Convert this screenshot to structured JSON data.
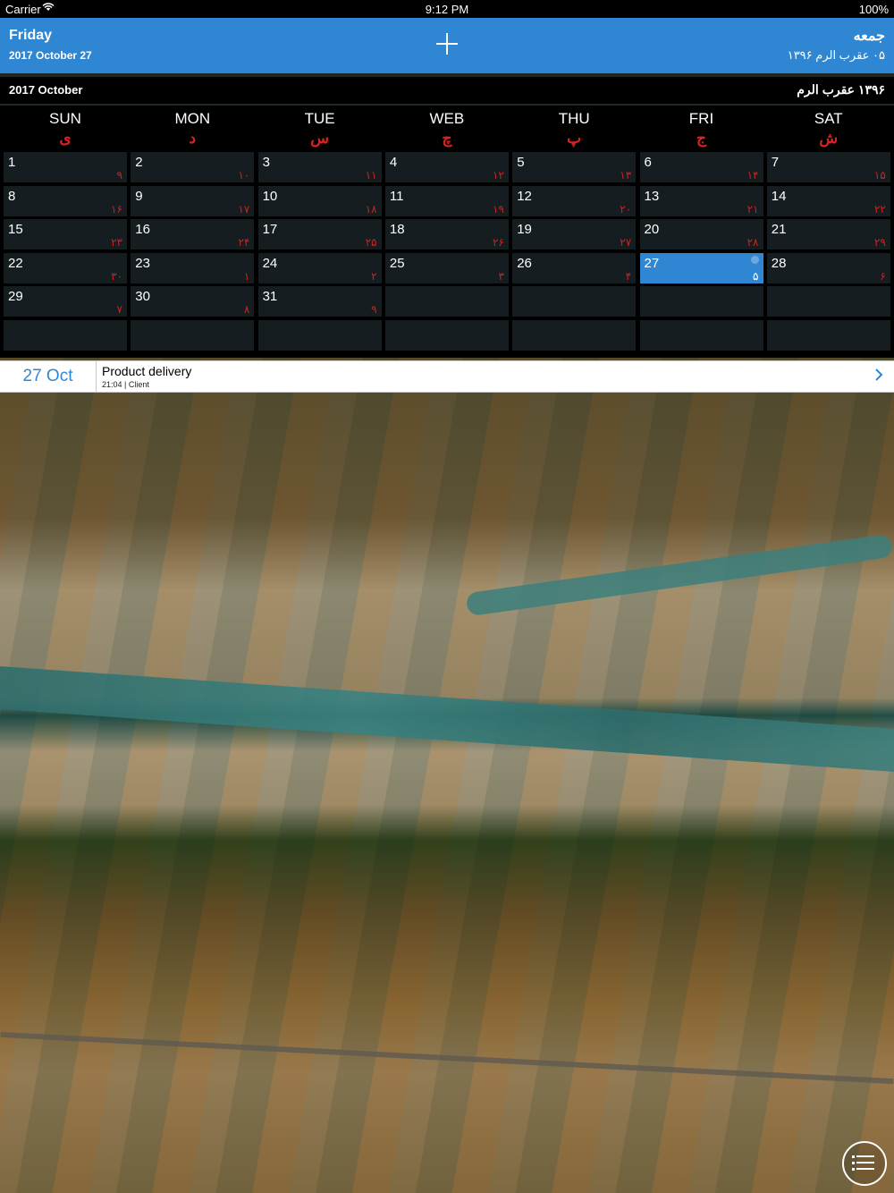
{
  "status_bar": {
    "carrier": "Carrier",
    "time": "9:12 PM",
    "battery": "100%"
  },
  "header": {
    "day_en": "Friday",
    "date_en": "2017 October 27",
    "day_fa": "جمعه",
    "date_fa": "۰۵ عقرب ا‌لرم ۱۳۹۶"
  },
  "month_bar": {
    "en": "2017 October",
    "fa": "۱۳۹۶ عقرب ا‌لرم"
  },
  "weekdays": [
    {
      "en": "SUN",
      "fa": "ی"
    },
    {
      "en": "MON",
      "fa": "د"
    },
    {
      "en": "TUE",
      "fa": "س"
    },
    {
      "en": "WEB",
      "fa": "چ"
    },
    {
      "en": "THU",
      "fa": "پ"
    },
    {
      "en": "FRI",
      "fa": "ج"
    },
    {
      "en": "SAT",
      "fa": "ش"
    }
  ],
  "days": [
    {
      "g": "1",
      "p": "۹"
    },
    {
      "g": "2",
      "p": "۱۰"
    },
    {
      "g": "3",
      "p": "۱۱"
    },
    {
      "g": "4",
      "p": "۱۲"
    },
    {
      "g": "5",
      "p": "۱۳"
    },
    {
      "g": "6",
      "p": "۱۴"
    },
    {
      "g": "7",
      "p": "۱۵"
    },
    {
      "g": "8",
      "p": "۱۶"
    },
    {
      "g": "9",
      "p": "۱۷"
    },
    {
      "g": "10",
      "p": "۱۸"
    },
    {
      "g": "11",
      "p": "۱۹"
    },
    {
      "g": "12",
      "p": "۲۰"
    },
    {
      "g": "13",
      "p": "۲۱"
    },
    {
      "g": "14",
      "p": "۲۲"
    },
    {
      "g": "15",
      "p": "۲۳"
    },
    {
      "g": "16",
      "p": "۲۴"
    },
    {
      "g": "17",
      "p": "۲۵"
    },
    {
      "g": "18",
      "p": "۲۶"
    },
    {
      "g": "19",
      "p": "۲۷"
    },
    {
      "g": "20",
      "p": "۲۸"
    },
    {
      "g": "21",
      "p": "۲۹"
    },
    {
      "g": "22",
      "p": "۳۰"
    },
    {
      "g": "23",
      "p": "۱"
    },
    {
      "g": "24",
      "p": "۲"
    },
    {
      "g": "25",
      "p": "۳"
    },
    {
      "g": "26",
      "p": "۴"
    },
    {
      "g": "27",
      "p": "۵",
      "today": true
    },
    {
      "g": "28",
      "p": "۶"
    },
    {
      "g": "29",
      "p": "۷"
    },
    {
      "g": "30",
      "p": "۸"
    },
    {
      "g": "31",
      "p": "۹"
    },
    {
      "g": "",
      "p": ""
    },
    {
      "g": "",
      "p": ""
    },
    {
      "g": "",
      "p": ""
    },
    {
      "g": "",
      "p": ""
    },
    {
      "g": "",
      "p": ""
    },
    {
      "g": "",
      "p": ""
    },
    {
      "g": "",
      "p": ""
    },
    {
      "g": "",
      "p": ""
    },
    {
      "g": "",
      "p": ""
    },
    {
      "g": "",
      "p": ""
    },
    {
      "g": "",
      "p": ""
    }
  ],
  "event": {
    "date": "27 Oct",
    "title": "Product delivery",
    "meta": "21:04 | Client"
  },
  "colors": {
    "accent": "#2f87d3",
    "persian_date": "#cc2222"
  },
  "icons": {
    "add": "plus-icon",
    "menu": "menu-list-icon",
    "chevron": "chevron-right-icon",
    "wifi": "wifi-icon"
  }
}
